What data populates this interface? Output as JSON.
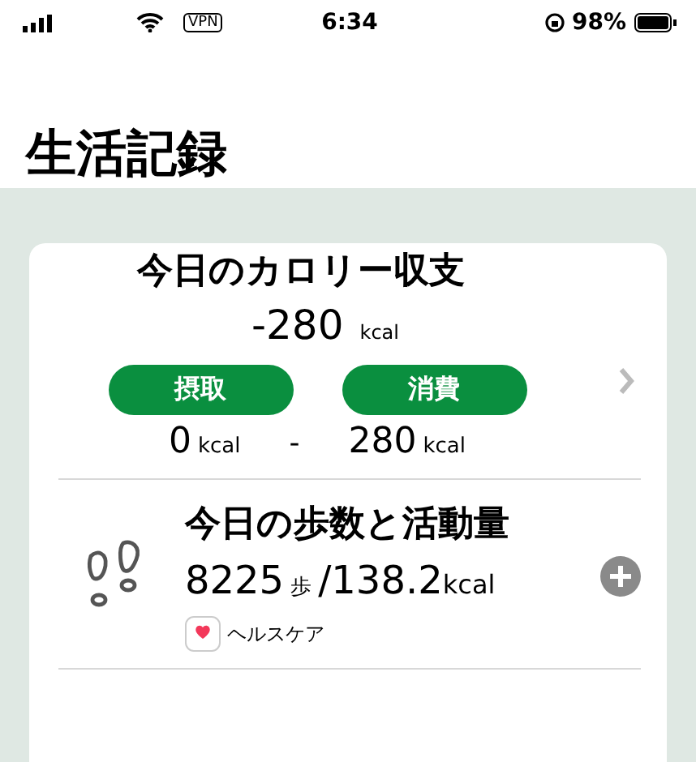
{
  "status_bar": {
    "vpn": "VPN",
    "time": "6:34",
    "battery": "98%"
  },
  "title": "生活記録",
  "calorie": {
    "title": "今日のカロリー収支",
    "balance": "-280",
    "balance_unit": "kcal",
    "intake_label": "摂取",
    "burn_label": "消費",
    "intake": "0",
    "intake_unit": "kcal",
    "separator": "-",
    "burn": "280",
    "burn_unit": "kcal"
  },
  "steps": {
    "title": "今日の歩数と活動量",
    "steps": "8225",
    "steps_unit": "歩",
    "kcal": "/138.2",
    "kcal_unit": "kcal",
    "source": "ヘルスケア"
  }
}
